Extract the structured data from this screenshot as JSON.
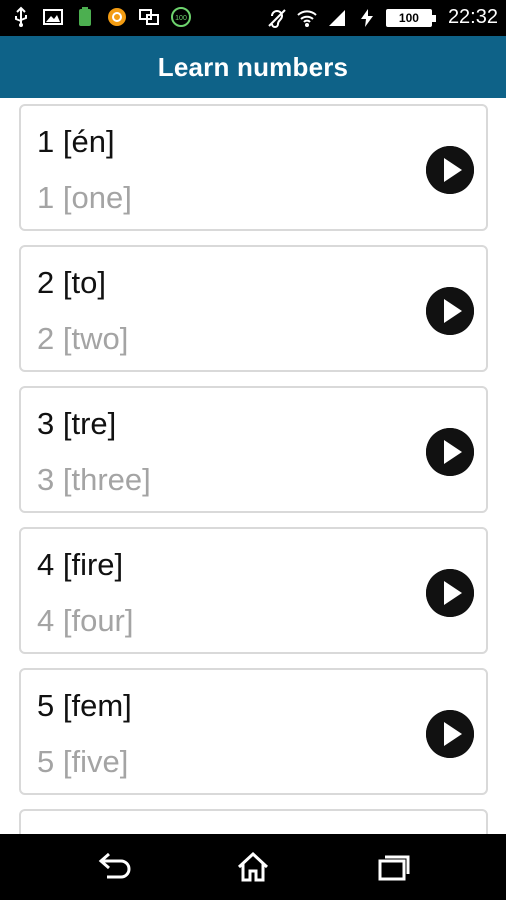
{
  "status_bar": {
    "time": "22:32",
    "battery": "100",
    "left_icons": [
      "usb-icon",
      "image-icon",
      "battery-app-icon",
      "orange-app-icon",
      "screen-mirror-icon",
      "battery-100-app-icon"
    ],
    "right_icons": [
      "hearing-aid-icon",
      "wifi-icon",
      "signal-icon",
      "charging-icon"
    ]
  },
  "app_bar": {
    "title": "Learn numbers",
    "color": "#0e6288"
  },
  "items": [
    {
      "primary": "1 [én]",
      "secondary": "1 [one]"
    },
    {
      "primary": "2 [to]",
      "secondary": "2 [two]"
    },
    {
      "primary": "3 [tre]",
      "secondary": "3 [three]"
    },
    {
      "primary": "4 [fire]",
      "secondary": "4 [four]"
    },
    {
      "primary": "5 [fem]",
      "secondary": "5 [five]"
    }
  ],
  "nav_bar": {
    "buttons": [
      "back-icon",
      "home-icon",
      "recent-apps-icon"
    ]
  }
}
